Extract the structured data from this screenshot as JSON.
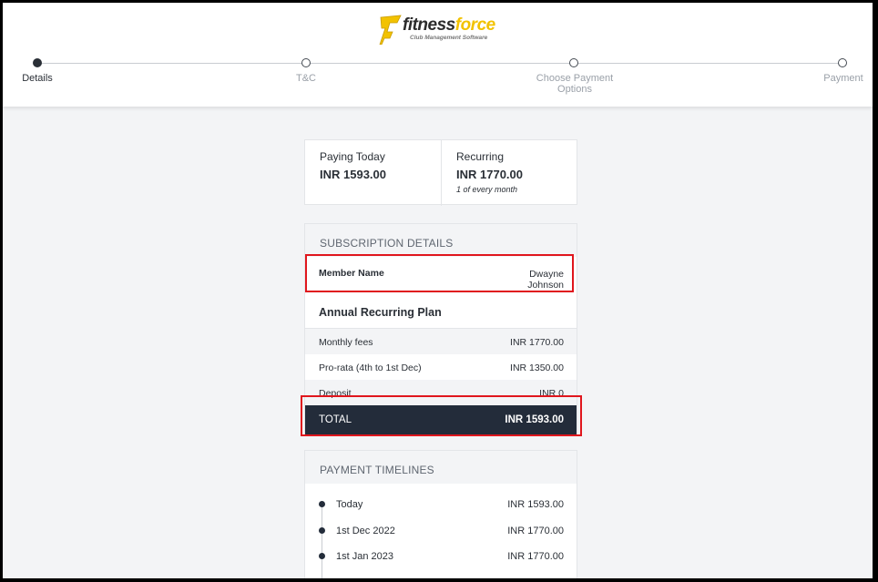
{
  "brand": {
    "name_part1": "fitness",
    "name_part2": "force",
    "tagline": "Club Management Software",
    "accent_color": "#f2c200"
  },
  "stepper": {
    "steps": [
      {
        "label": "Details",
        "active": true
      },
      {
        "label": "T&C",
        "active": false
      },
      {
        "label": "Choose Payment Options",
        "active": false
      },
      {
        "label": "Payment",
        "active": false
      }
    ]
  },
  "summary": {
    "paying_today_label": "Paying Today",
    "paying_today_amount": "INR 1593.00",
    "recurring_label": "Recurring",
    "recurring_amount": "INR 1770.00",
    "recurring_note": "1 of every month"
  },
  "subscription": {
    "title": "SUBSCRIPTION DETAILS",
    "member_label": "Member Name",
    "member_value": "Dwayne Johnson",
    "plan_name": "Annual Recurring Plan",
    "fees": [
      {
        "label": "Monthly fees",
        "value": "INR 1770.00"
      },
      {
        "label": "Pro-rata (4th to 1st Dec)",
        "value": "INR 1350.00"
      },
      {
        "label": "Deposit",
        "value": "INR 0"
      }
    ],
    "total_label": "TOTAL",
    "total_value": "INR 1593.00"
  },
  "timelines": {
    "title": "PAYMENT TIMELINES",
    "items": [
      {
        "label": "Today",
        "value": "INR 1593.00"
      },
      {
        "label": "1st Dec 2022",
        "value": "INR 1770.00"
      },
      {
        "label": "1st Jan 2023",
        "value": "INR 1770.00"
      }
    ]
  },
  "colors": {
    "highlight": "#e0161d",
    "dark": "#232c3a",
    "page_bg": "#f3f4f6"
  }
}
